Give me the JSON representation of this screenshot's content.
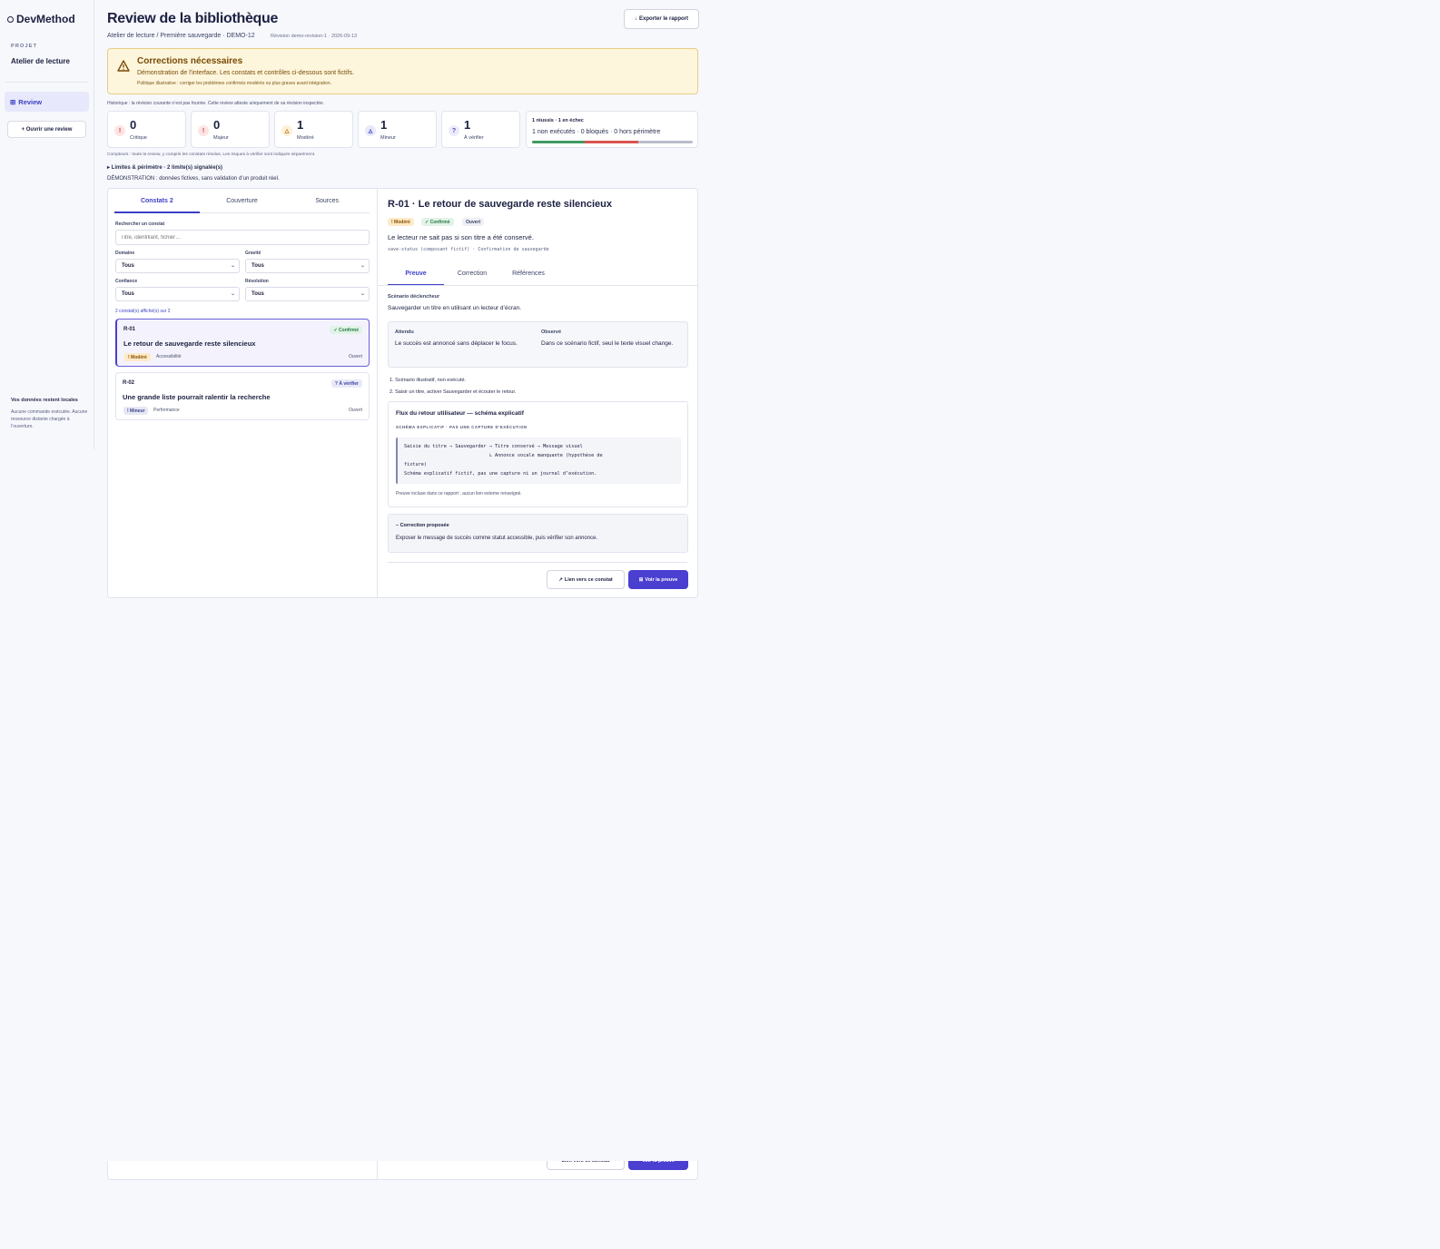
{
  "app": {
    "name": "DevMethod"
  },
  "sidebar": {
    "project_label": "PROJET",
    "project_name": "Atelier de lecture",
    "nav_review": "Review",
    "open_review": "+ Ouvrir une review",
    "local_title": "Vos données restent locales",
    "local_text": "Aucune commande exécutée. Aucune ressource distante chargée à l’ouverture."
  },
  "header": {
    "title": "Review de la bibliothèque",
    "breadcrumb": "Atelier de lecture / Première sauvegarde · DEMO-12",
    "revision": "Révision demo-revision-1 · 2026-09-13",
    "export": "Exporter le rapport"
  },
  "alert": {
    "title": "Corrections nécessaires",
    "text": "Démonstration de l’interface. Les constats et contrôles ci-dessous sont fictifs.",
    "policy": "Politique illustrative : corriger les problèmes confirmés modérés ou plus graves avant intégration."
  },
  "history": "Historique : la révision courante n’est pas fournie. Cette review atteste uniquement de sa révision inspectée.",
  "stats": [
    {
      "value": "0",
      "label": "Critique",
      "icon": "!"
    },
    {
      "value": "0",
      "label": "Majeur",
      "icon": "!"
    },
    {
      "value": "1",
      "label": "Modéré",
      "icon": "△"
    },
    {
      "value": "1",
      "label": "Mineur",
      "icon": "◬"
    },
    {
      "value": "1",
      "label": "À vérifier",
      "icon": "?"
    }
  ],
  "tests": {
    "title": "1 réussis · 1 en échec",
    "sub": "1 non exécutés · 0 bloqués · 0 hors périmètre",
    "pass_fraction": 0.33,
    "fail_fraction": 0.33,
    "colors": {
      "pass": "#3f9a62",
      "fail": "#d9534f",
      "other": "#b8bccb"
    }
  },
  "counters_note": "Compteurs : toute la review, y compris les constats résolus. Les risques à vérifier sont indiqués séparément.",
  "limits": "▸ Limites & périmètre · 2 limite(s) signalée(s)",
  "demo_note": "DÉMONSTRATION : données fictives, sans validation d’un produit réel.",
  "list": {
    "tabs": [
      "Constats 2",
      "Couverture",
      "Sources"
    ],
    "search_label": "Rechercher un constat",
    "search_placeholder": "Titre, identifiant, fichier…",
    "filters": [
      {
        "label": "Domaine",
        "value": "Tous"
      },
      {
        "label": "Gravité",
        "value": "Tous"
      },
      {
        "label": "Confiance",
        "value": "Tous"
      },
      {
        "label": "Résolution",
        "value": "Tous"
      }
    ],
    "count_note": "2 constat(s) affiché(s) sur 2",
    "items": [
      {
        "id": "R-01",
        "title": "Le retour de sauvegarde reste silencieux",
        "confidence": "✓ Confirmé",
        "severity": "! Modéré",
        "category": "Accessibilité",
        "status": "Ouvert"
      },
      {
        "id": "R-02",
        "title": "Une grande liste pourrait ralentir la recherche",
        "confidence": "? À vérifier",
        "severity": "! Mineur",
        "category": "Performance",
        "status": "Ouvert"
      }
    ]
  },
  "detail": {
    "title": "R-01 · Le retour de sauvegarde reste silencieux",
    "badges": [
      "! Modéré",
      "✓ Confirmé",
      "Ouvert"
    ],
    "subtitle": "Le lecteur ne sait pas si son titre a été conservé.",
    "code": "save-status (composant fictif) · Confirmation de sauvegarde",
    "tabs": [
      "Preuve",
      "Correction",
      "Références"
    ],
    "scenario_label": "Scénario déclencheur",
    "scenario_text": "Sauvegarder un titre en utilisant un lecteur d’écran.",
    "expected_label": "Attendu",
    "expected_text": "Le succès est annoncé sans déplacer le focus.",
    "observed_label": "Observé",
    "observed_text": "Dans ce scénario fictif, seul le texte visuel change.",
    "steps": [
      "1. Scénario illustratif, non exécuté.",
      "2. Saisir un titre, activer Sauvegarder et écouter le retour."
    ],
    "flow_title": "Flux du retour utilisateur — schéma explicatif",
    "flow_caption": "SCHÉMA EXPLICATIF · PAS UNE CAPTURE D’EXÉCUTION",
    "flow_code": "Saisie du titre → Sauvegarder → Titre conservé → Message visuel\n                              ↳ Annonce vocale manquante (hypothèse de\nfixture)\nSchéma explicatif fictif, pas une capture ni un journal d’exécution.",
    "flow_note": "Preuve incluse dans ce rapport ; aucun lien externe renseigné.",
    "fix_title": "– Correction proposée",
    "fix_text": "Exposer le message de succès comme statut accessible, puis vérifier son annonce.",
    "link_button": "Lien vers ce constat",
    "proof_button": "Voir la preuve"
  },
  "colors": {
    "accent": "#4a3fd0",
    "alert_bg": "#fdf5dc",
    "alert_text": "#7a4b04"
  }
}
